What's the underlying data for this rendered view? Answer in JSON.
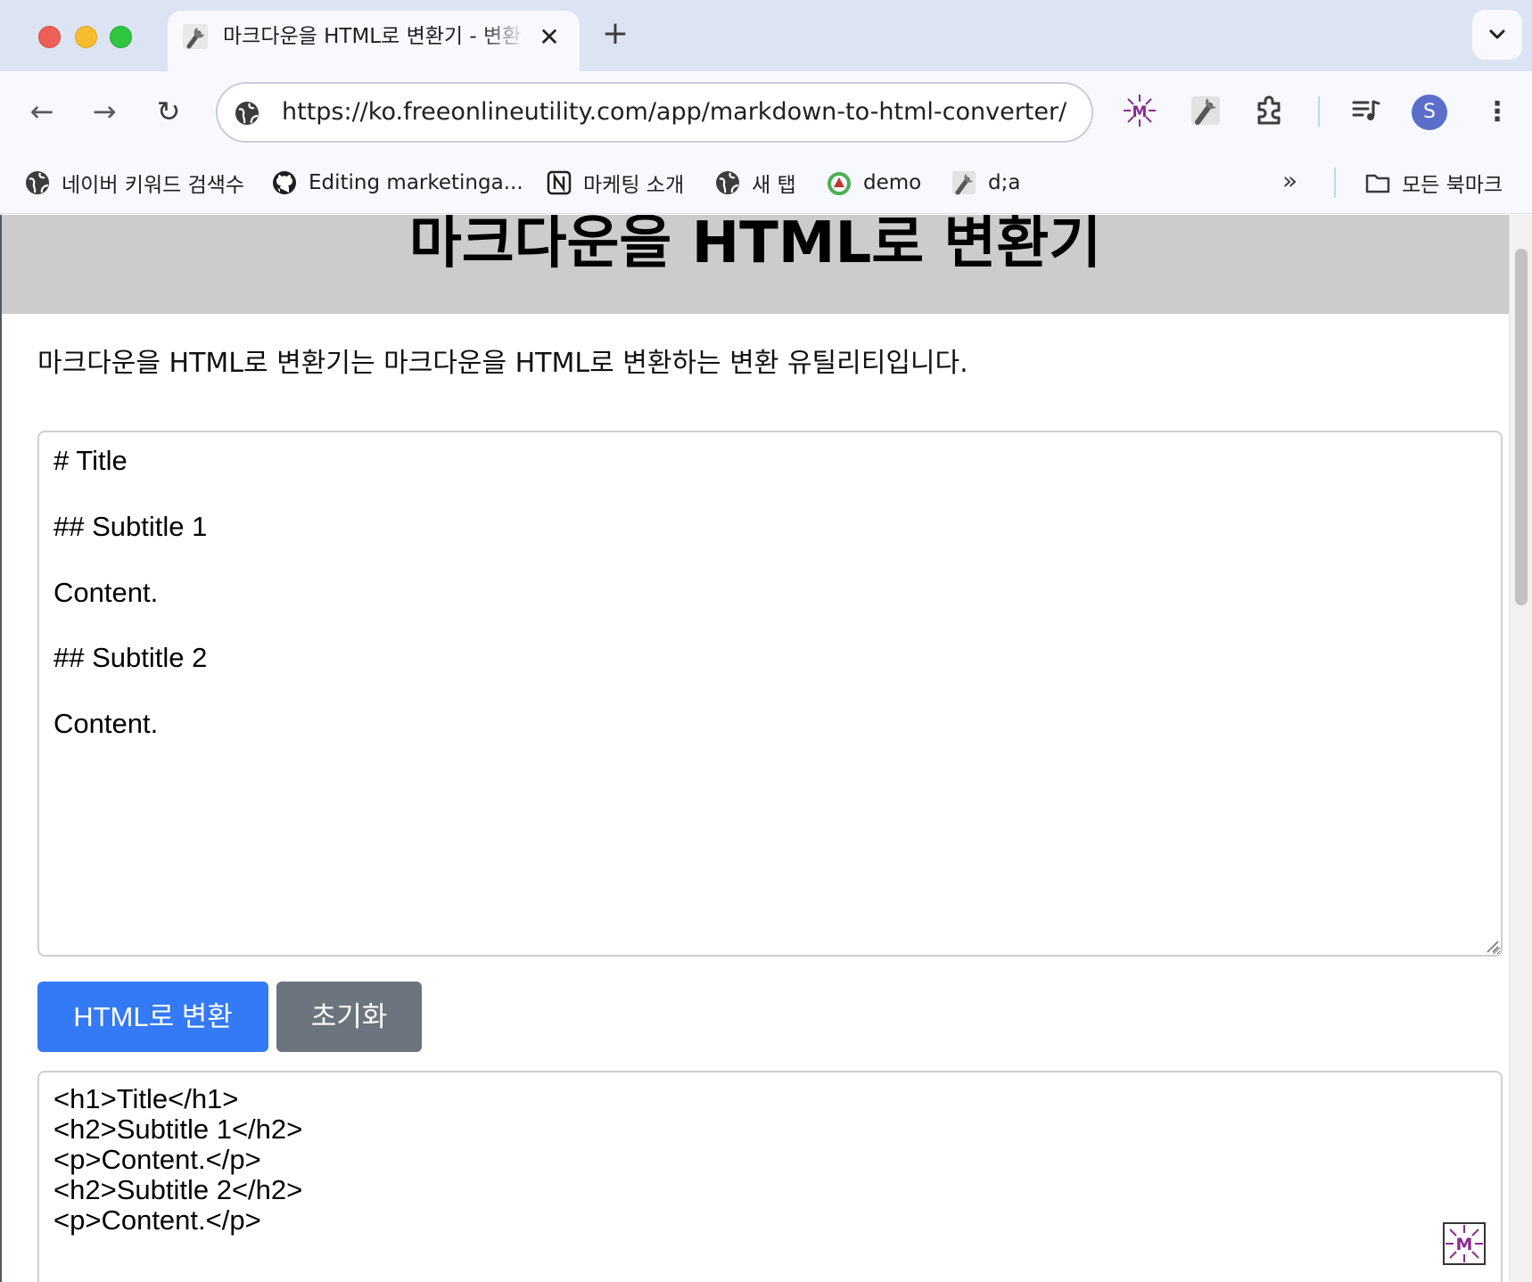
{
  "browser": {
    "tab": {
      "title": "마크다운을 HTML로 변환기 - 변환",
      "close_glyph": "✕",
      "favicon": "wrench-icon"
    },
    "new_tab_glyph": "+",
    "tab_search_glyph": "⌄",
    "nav": {
      "back_glyph": "←",
      "forward_glyph": "→",
      "reload_glyph": "↻"
    },
    "address_bar": {
      "url": "https://ko.freeonlineutility.com/app/markdown-to-html-converter/"
    },
    "extensions": [
      "mail-merge-extension-icon",
      "wrench-extension-icon",
      "extensions-puzzle-icon",
      "media-control-icon"
    ],
    "profile_initial": "S",
    "menu_glyph": "⋮",
    "bookmarks": [
      {
        "label": "네이버 키워드 검색수",
        "icon": "globe-icon"
      },
      {
        "label": "Editing marketinga...",
        "icon": "github-icon"
      },
      {
        "label": "마케팅 소개",
        "icon": "notion-icon"
      },
      {
        "label": "새 탭",
        "icon": "globe-icon"
      },
      {
        "label": "demo",
        "icon": "recycle-icon"
      },
      {
        "label": "d;a",
        "icon": "wrench-icon"
      }
    ],
    "bookmarks_overflow_glyph": "»",
    "all_bookmarks_label": "모든 북마크"
  },
  "page": {
    "title": "마크다운을 HTML로 변환기",
    "description": "마크다운을 HTML로 변환기는 마크다운을 HTML로 변환하는 변환 유틸리티입니다.",
    "markdown_input": "# Title\n\n## Subtitle 1\n\nContent.\n\n## Subtitle 2\n\nContent.",
    "convert_button": "HTML로 변환",
    "reset_button": "초기화",
    "html_output": "<h1>Title</h1>\n<h2>Subtitle 1</h2>\n<p>Content.</p>\n<h2>Subtitle 2</h2>\n<p>Content.</p>"
  },
  "colors": {
    "tab_strip": "#dce3f3",
    "toolbar": "#f7f9fe",
    "header_band": "#cccccc",
    "convert_button": "#3479f6",
    "reset_button": "#6c757d",
    "avatar": "#5b6ec9"
  }
}
